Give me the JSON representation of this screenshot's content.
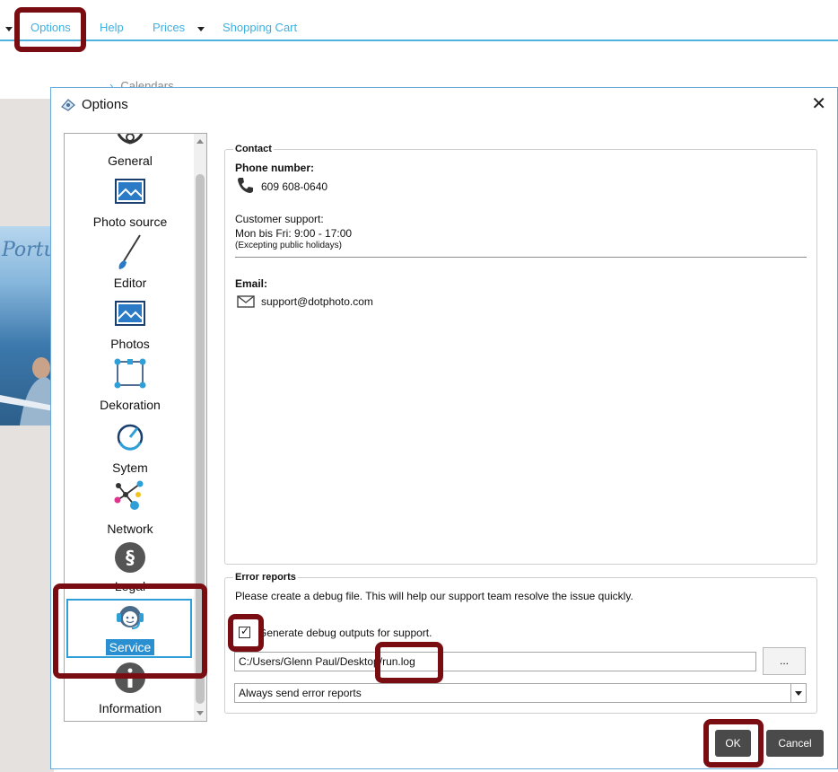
{
  "top_menu": {
    "options": "Options",
    "help": "Help",
    "prices": "Prices",
    "cart": "Shopping Cart"
  },
  "background": {
    "crumb": "Calendars",
    "photo_text": "Portu"
  },
  "dialog": {
    "title": "Options",
    "close_glyph": "✕"
  },
  "nav": {
    "items": [
      {
        "label": "General",
        "icon": "gear-icon"
      },
      {
        "label": "Photo source",
        "icon": "photo-source-icon"
      },
      {
        "label": "Editor",
        "icon": "brush-icon"
      },
      {
        "label": "Photos",
        "icon": "photos-icon"
      },
      {
        "label": "Dekoration",
        "icon": "decoration-icon"
      },
      {
        "label": "Sytem",
        "icon": "system-gauge-icon"
      },
      {
        "label": "Network",
        "icon": "network-icon"
      },
      {
        "label": "Legal",
        "icon": "paragraph-icon"
      },
      {
        "label": "Service",
        "icon": "headset-icon"
      },
      {
        "label": "Information",
        "icon": "info-icon"
      }
    ],
    "selected": "Service"
  },
  "contact": {
    "title": "Contact",
    "phone_label": "Phone number:",
    "phone": "609 608-0640",
    "support_label": "Customer support:",
    "hours": "Mon bis Fri: 9:00 - 17:00",
    "hours_note": "(Excepting public holidays)",
    "email_label": "Email:",
    "email": "support@dotphoto.com"
  },
  "error_reports": {
    "title": "Error reports",
    "description": "Please create a debug file. This will help our support team resolve the issue quickly.",
    "checkbox_label": "Generate debug outputs for support.",
    "checked": true,
    "path": "C:/Users/Glenn Paul/Desktop/run.log",
    "browse_label": "...",
    "send_option": "Always send error reports"
  },
  "buttons": {
    "ok": "OK",
    "cancel": "Cancel"
  },
  "colors": {
    "accent": "#3fb0e0",
    "highlight": "#7a0d12",
    "selection": "#2a8fd0"
  }
}
